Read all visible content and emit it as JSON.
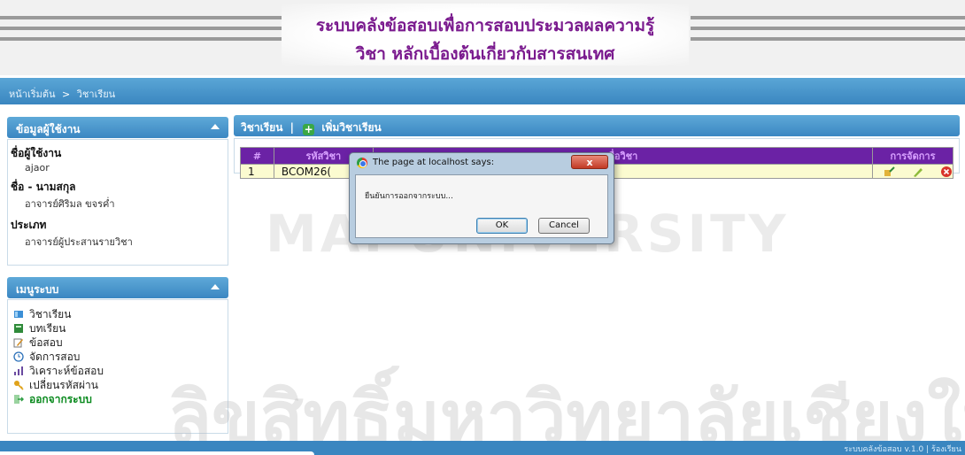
{
  "header": {
    "title_line1": "ระบบคลังข้อสอบเพื่อการสอบประมวลผลความรู้",
    "title_line2": "วิชา หลักเบื้องต้นเกี่ยวกับสารสนเทศ"
  },
  "breadcrumb": {
    "home": "หน้าเริ่มต้น",
    "separator": ">",
    "current": "วิชาเรียน"
  },
  "user_panel": {
    "title": "ข้อมูลผู้ใช้งาน",
    "username_label": "ชื่อผู้ใช้งาน",
    "username": "ajaor",
    "fullname_label": "ชื่อ - นามสกุล",
    "fullname": "อาจารย์ศิริมล ขจรค่ำ",
    "type_label": "ประเภท",
    "type": "อาจารย์ผู้ประสานรายวิชา"
  },
  "menu_panel": {
    "title": "เมนูระบบ",
    "items": [
      {
        "label": "วิชาเรียน",
        "icon": "book-icon",
        "color": "#3b8fd6"
      },
      {
        "label": "บทเรียน",
        "icon": "lesson-icon",
        "color": "#2f8a3a"
      },
      {
        "label": "ข้อสอบ",
        "icon": "edit-icon",
        "color": "#d28a1a"
      },
      {
        "label": "จัดการสอบ",
        "icon": "clock-icon",
        "color": "#2a6fb8"
      },
      {
        "label": "วิเคราะห์ข้อสอบ",
        "icon": "chart-icon",
        "color": "#6a4aa0"
      },
      {
        "label": "เปลี่ยนรหัสผ่าน",
        "icon": "key-icon",
        "color": "#e0a21a"
      },
      {
        "label": "ออกจากระบบ",
        "icon": "logout-icon",
        "color": "#2f9e44"
      }
    ]
  },
  "main": {
    "title": "วิชาเรียน",
    "separator": "|",
    "add_label": "เพิ่มวิชาเรียน",
    "table": {
      "headers": [
        "#",
        "รหัสวิชา",
        "ชื่อวิชา",
        "การจัดการ"
      ],
      "rows": [
        {
          "no": "1",
          "code": "BCOM26("
        }
      ]
    }
  },
  "dialog": {
    "title": "The page at localhost says:",
    "message": "ยืนยันการออกจากระบบ...",
    "ok_label": "OK",
    "cancel_label": "Cancel",
    "close_label": "x"
  },
  "footer": {
    "version_text": "ระบบคลังข้อสอบ v.1.0 | ร้องเรียน"
  },
  "watermark": {
    "main": "ลิขสิทธิ์มหาวิทยาลัยเชียงใหม่",
    "arc": "MAI UNIVERSITY"
  }
}
